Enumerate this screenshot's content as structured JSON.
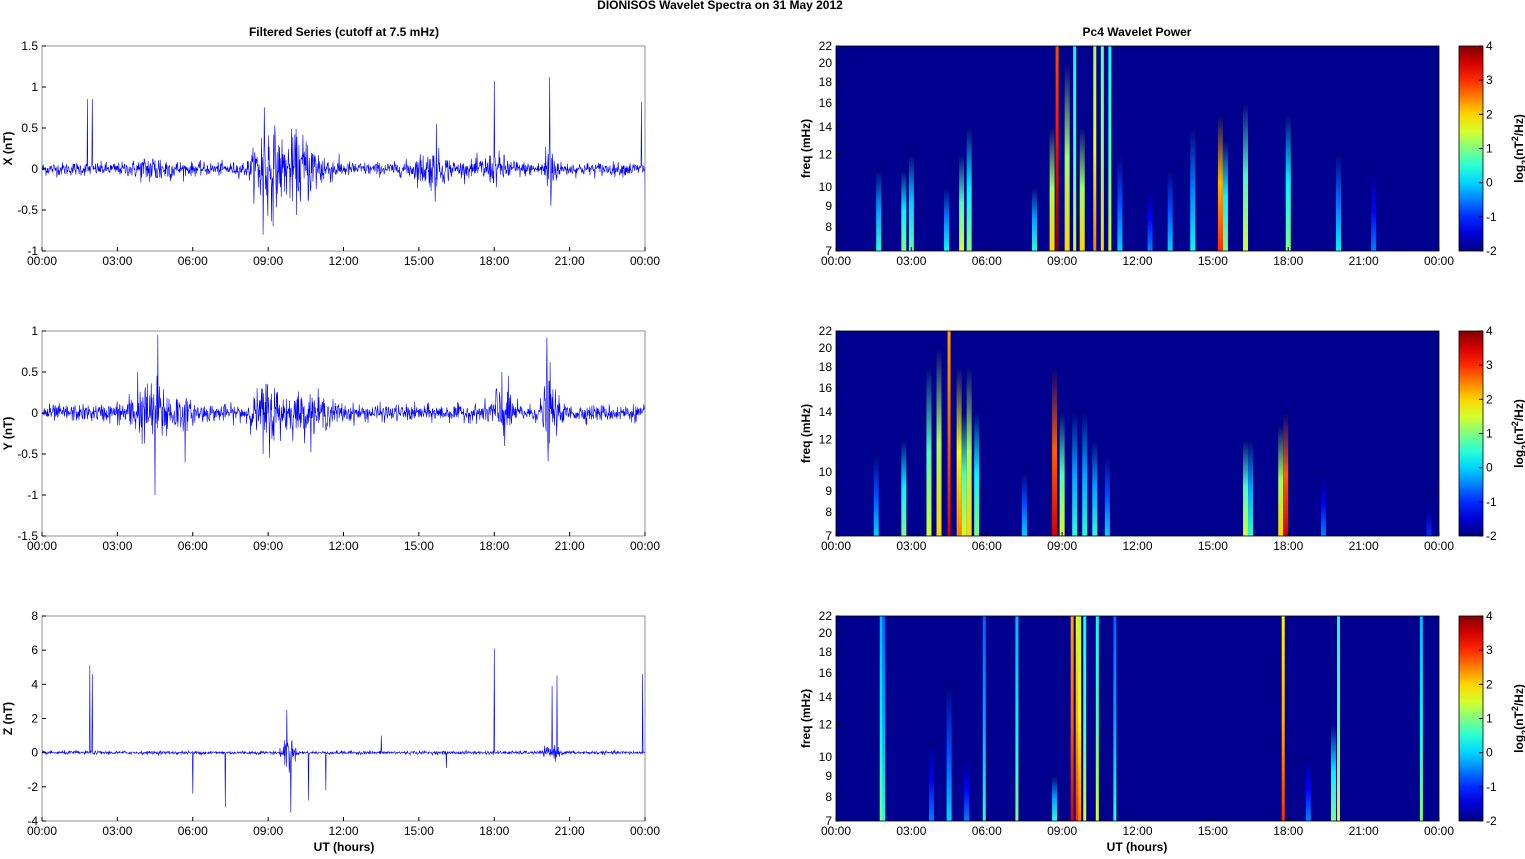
{
  "title": "DIONISOS Wavelet Spectra on 31 May      2012",
  "left_title": "Filtered Series (cutoff at 7.5 mHz)",
  "right_title": "Pc4 Wavelet Power",
  "xlabel": "UT (hours)",
  "x_ticks": [
    "00:00",
    "03:00",
    "06:00",
    "09:00",
    "12:00",
    "15:00",
    "18:00",
    "21:00",
    "00:00"
  ],
  "colorbar_label_parts": [
    "log",
    "2",
    "(nT",
    "2",
    "/Hz)"
  ],
  "colorbar_ticks": [
    "4",
    "3",
    "2",
    "1",
    "0",
    "-1",
    "-2"
  ],
  "colors": {
    "series": "#0000ff",
    "background": "#00008f"
  },
  "chart_data": [
    {
      "type": "line",
      "component": "X",
      "ylabel": "X (nT)",
      "xlim": [
        0,
        24
      ],
      "ylim": [
        -1,
        1.5
      ],
      "y_ticks": [
        "1.5",
        "1",
        "0.5",
        "0",
        "-0.5",
        "-1"
      ],
      "y_tick_values": [
        1.5,
        1,
        0.5,
        0,
        -0.5,
        -1
      ],
      "noise_level": 0.04,
      "bursts": [
        {
          "t": 8.9,
          "amp": 0.25,
          "width": 0.6
        },
        {
          "t": 10.2,
          "amp": 0.18,
          "width": 1.5
        },
        {
          "t": 4.5,
          "amp": 0.06,
          "width": 1
        },
        {
          "t": 20.2,
          "amp": 0.2,
          "width": 0.3
        },
        {
          "t": 15.5,
          "amp": 0.08,
          "width": 1
        },
        {
          "t": 18,
          "amp": 0.06,
          "width": 1
        }
      ],
      "spikes": [
        {
          "t": 1.8,
          "v": 0.85
        },
        {
          "t": 2.0,
          "v": 0.85
        },
        {
          "t": 8.8,
          "v": -0.8
        },
        {
          "t": 8.85,
          "v": 0.75
        },
        {
          "t": 15.7,
          "v": 0.55
        },
        {
          "t": 15.65,
          "v": -0.4
        },
        {
          "t": 18.0,
          "v": 1.07
        },
        {
          "t": 20.2,
          "v": 1.12
        },
        {
          "t": 20.25,
          "v": -0.45
        },
        {
          "t": 23.85,
          "v": 0.82
        },
        {
          "t": 24,
          "v": -0.35
        }
      ]
    },
    {
      "type": "line",
      "component": "Y",
      "ylabel": "Y (nT)",
      "xlim": [
        0,
        24
      ],
      "ylim": [
        -1.5,
        1
      ],
      "y_ticks": [
        "1",
        "0.5",
        "0",
        "-0.5",
        "-1",
        "-1.5"
      ],
      "y_tick_values": [
        1,
        0.5,
        0,
        -0.5,
        -1,
        -1.5
      ],
      "noise_level": 0.05,
      "bursts": [
        {
          "t": 4.5,
          "amp": 0.15,
          "width": 1.5
        },
        {
          "t": 9.0,
          "amp": 0.15,
          "width": 0.8
        },
        {
          "t": 10.5,
          "amp": 0.08,
          "width": 1.5
        },
        {
          "t": 18.3,
          "amp": 0.15,
          "width": 0.6
        },
        {
          "t": 20.2,
          "amp": 0.2,
          "width": 0.4
        }
      ],
      "spikes": [
        {
          "t": 4.6,
          "v": 0.95
        },
        {
          "t": 4.5,
          "v": -1.0
        },
        {
          "t": 5.7,
          "v": -0.6
        },
        {
          "t": 20.1,
          "v": 0.92
        },
        {
          "t": 18.3,
          "v": 0.5
        },
        {
          "t": 3.8,
          "v": 0.5
        },
        {
          "t": 8.8,
          "v": -0.5
        }
      ]
    },
    {
      "type": "line",
      "component": "Z",
      "ylabel": "Z (nT)",
      "xlim": [
        0,
        24
      ],
      "ylim": [
        -4,
        8
      ],
      "y_ticks": [
        "8",
        "6",
        "4",
        "2",
        "0",
        "-2",
        "-4"
      ],
      "y_tick_values": [
        8,
        6,
        4,
        2,
        0,
        -2,
        -4
      ],
      "noise_level": 0.05,
      "bursts": [
        {
          "t": 9.8,
          "amp": 0.6,
          "width": 0.3
        },
        {
          "t": 20.3,
          "amp": 0.2,
          "width": 0.4
        }
      ],
      "spikes": [
        {
          "t": 1.9,
          "v": 5.1
        },
        {
          "t": 2.0,
          "v": 4.6
        },
        {
          "t": 6.0,
          "v": -2.4
        },
        {
          "t": 7.3,
          "v": -3.2
        },
        {
          "t": 9.75,
          "v": 2.5
        },
        {
          "t": 9.9,
          "v": -3.5
        },
        {
          "t": 10.6,
          "v": -2.8
        },
        {
          "t": 11.3,
          "v": -2.2
        },
        {
          "t": 13.5,
          "v": 1.0
        },
        {
          "t": 18.0,
          "v": 6.1
        },
        {
          "t": 20.5,
          "v": 4.5
        },
        {
          "t": 20.3,
          "v": 3.9
        },
        {
          "t": 23.9,
          "v": 4.6
        },
        {
          "t": 16.1,
          "v": -0.9
        }
      ]
    },
    {
      "type": "heatmap",
      "component": "X",
      "ylabel": "freq (mHz)",
      "xlim": [
        0,
        24
      ],
      "ylim": [
        7,
        22
      ],
      "yscale": "log",
      "clim": [
        -2,
        4
      ],
      "y_ticks": [
        "22",
        "20",
        "18",
        "16",
        "14",
        "12",
        "10",
        "9",
        "8",
        "7"
      ],
      "y_tick_values": [
        22,
        20,
        18,
        16,
        14,
        12,
        10,
        9,
        8,
        7
      ],
      "events": [
        {
          "t": 1.7,
          "level": 0.5,
          "fmax": 11
        },
        {
          "t": 2.7,
          "level": 1,
          "fmax": 11
        },
        {
          "t": 3.0,
          "level": 0.8,
          "fmax": 12
        },
        {
          "t": 4.4,
          "level": 0.3,
          "fmax": 10
        },
        {
          "t": 5.0,
          "level": 1.5,
          "fmax": 12
        },
        {
          "t": 5.3,
          "level": 1,
          "fmax": 14
        },
        {
          "t": 7.9,
          "level": 0.5,
          "fmax": 10
        },
        {
          "t": 8.6,
          "level": 2,
          "fmax": 14
        },
        {
          "t": 8.8,
          "level": 4,
          "fmax": 22
        },
        {
          "t": 9.2,
          "level": 2,
          "fmax": 20
        },
        {
          "t": 9.5,
          "level": 1.5,
          "fmax": 22
        },
        {
          "t": 9.8,
          "level": 2,
          "fmax": 14
        },
        {
          "t": 10.3,
          "level": 2.5,
          "fmax": 22
        },
        {
          "t": 10.6,
          "level": 2,
          "fmax": 22
        },
        {
          "t": 10.9,
          "level": 1.5,
          "fmax": 22
        },
        {
          "t": 11.3,
          "level": 0,
          "fmax": 12
        },
        {
          "t": 12.5,
          "level": -0.5,
          "fmax": 10
        },
        {
          "t": 13.3,
          "level": 0,
          "fmax": 11
        },
        {
          "t": 14.2,
          "level": 0.3,
          "fmax": 14
        },
        {
          "t": 15.3,
          "level": 3,
          "fmax": 15
        },
        {
          "t": 15.5,
          "level": 1,
          "fmax": 13
        },
        {
          "t": 16.3,
          "level": 1.5,
          "fmax": 16
        },
        {
          "t": 18.0,
          "level": 1,
          "fmax": 15
        },
        {
          "t": 20.0,
          "level": 0.2,
          "fmax": 12
        },
        {
          "t": 21.4,
          "level": -0.5,
          "fmax": 11
        }
      ]
    },
    {
      "type": "heatmap",
      "component": "Y",
      "ylabel": "freq (mHz)",
      "xlim": [
        0,
        24
      ],
      "ylim": [
        7,
        22
      ],
      "yscale": "log",
      "clim": [
        -2,
        4
      ],
      "y_ticks": [
        "22",
        "20",
        "18",
        "16",
        "14",
        "12",
        "10",
        "9",
        "8",
        "7"
      ],
      "y_tick_values": [
        22,
        20,
        18,
        16,
        14,
        12,
        10,
        9,
        8,
        7
      ],
      "events": [
        {
          "t": 1.6,
          "level": 0,
          "fmax": 11
        },
        {
          "t": 2.7,
          "level": 1,
          "fmax": 12
        },
        {
          "t": 3.7,
          "level": 1.5,
          "fmax": 18
        },
        {
          "t": 4.1,
          "level": 2,
          "fmax": 20
        },
        {
          "t": 4.5,
          "level": 3.5,
          "fmax": 22
        },
        {
          "t": 4.9,
          "level": 2.5,
          "fmax": 18
        },
        {
          "t": 5.1,
          "level": 1.5,
          "fmax": 14
        },
        {
          "t": 5.3,
          "level": 2,
          "fmax": 18
        },
        {
          "t": 5.6,
          "level": 1,
          "fmax": 14
        },
        {
          "t": 7.5,
          "level": 0,
          "fmax": 10
        },
        {
          "t": 8.7,
          "level": 3.5,
          "fmax": 18
        },
        {
          "t": 9.0,
          "level": 1.5,
          "fmax": 14
        },
        {
          "t": 9.5,
          "level": 0.5,
          "fmax": 14
        },
        {
          "t": 9.9,
          "level": 0.5,
          "fmax": 14
        },
        {
          "t": 10.3,
          "level": 0.5,
          "fmax": 12
        },
        {
          "t": 10.8,
          "level": 0,
          "fmax": 11
        },
        {
          "t": 16.3,
          "level": 1.5,
          "fmax": 12
        },
        {
          "t": 16.5,
          "level": 0.5,
          "fmax": 12
        },
        {
          "t": 17.7,
          "level": 2,
          "fmax": 13
        },
        {
          "t": 17.9,
          "level": 3.5,
          "fmax": 14
        },
        {
          "t": 19.4,
          "level": -0.5,
          "fmax": 10
        },
        {
          "t": 23.6,
          "level": -1,
          "fmax": 9
        }
      ]
    },
    {
      "type": "heatmap",
      "component": "Z",
      "ylabel": "freq (mHz)",
      "xlim": [
        0,
        24
      ],
      "ylim": [
        7,
        22
      ],
      "yscale": "log",
      "clim": [
        -2,
        4
      ],
      "y_ticks": [
        "22",
        "20",
        "18",
        "16",
        "14",
        "12",
        "10",
        "9",
        "8",
        "7"
      ],
      "y_tick_values": [
        22,
        20,
        18,
        16,
        14,
        12,
        10,
        9,
        8,
        7
      ],
      "events": [
        {
          "t": 1.8,
          "level": 1,
          "fmax": 22
        },
        {
          "t": 1.9,
          "level": 0.5,
          "fmax": 22
        },
        {
          "t": 3.8,
          "level": -0.5,
          "fmax": 11
        },
        {
          "t": 4.5,
          "level": 0,
          "fmax": 15
        },
        {
          "t": 5.2,
          "level": -0.5,
          "fmax": 10
        },
        {
          "t": 5.9,
          "level": 0.5,
          "fmax": 22
        },
        {
          "t": 7.2,
          "level": 1,
          "fmax": 22
        },
        {
          "t": 8.7,
          "level": 0.5,
          "fmax": 9
        },
        {
          "t": 9.4,
          "level": 3.5,
          "fmax": 22
        },
        {
          "t": 9.6,
          "level": 3,
          "fmax": 22
        },
        {
          "t": 9.7,
          "level": 2.5,
          "fmax": 22
        },
        {
          "t": 9.9,
          "level": 1.5,
          "fmax": 22
        },
        {
          "t": 10.4,
          "level": 1.5,
          "fmax": 22
        },
        {
          "t": 11.1,
          "level": 0.5,
          "fmax": 22
        },
        {
          "t": 17.8,
          "level": 3,
          "fmax": 22
        },
        {
          "t": 18.8,
          "level": -0.5,
          "fmax": 10
        },
        {
          "t": 19.8,
          "level": 1,
          "fmax": 12
        },
        {
          "t": 20.0,
          "level": 1.5,
          "fmax": 22
        },
        {
          "t": 23.3,
          "level": 1,
          "fmax": 22
        }
      ]
    }
  ]
}
